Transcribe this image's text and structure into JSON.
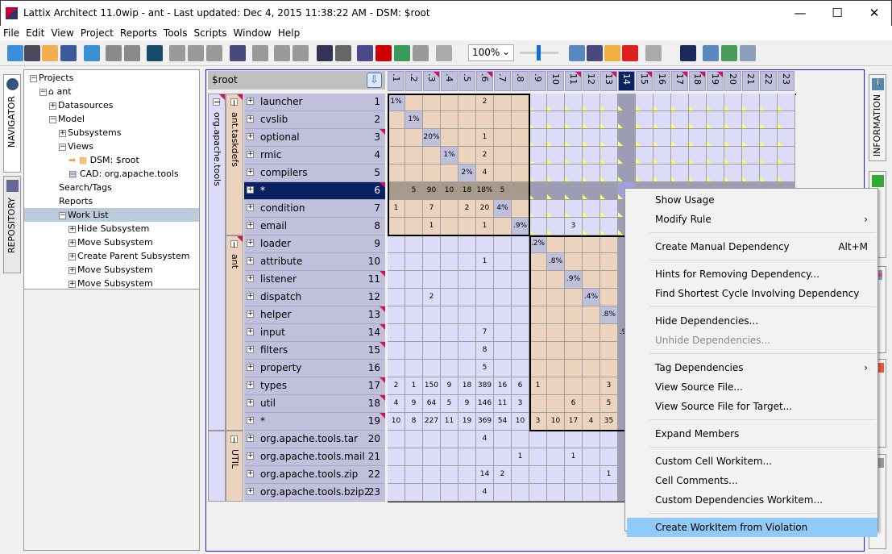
{
  "window": {
    "title": "Lattix Architect 11.0wip - ant - Last updated: Dec 4, 2015 11:38:22 AM - DSM: $root",
    "minimize": "—",
    "maximize": "☐",
    "close": "✕"
  },
  "menu": [
    "File",
    "Edit",
    "View",
    "Project",
    "Reports",
    "Tools",
    "Scripts",
    "Window",
    "Help"
  ],
  "toolbar": {
    "zoom": "100%",
    "zoom_slider_percent": 50,
    "icons": [
      "new-project-icon",
      "repository-icon",
      "open-icon",
      "save-icon",
      "refresh-icon",
      "undo-icon",
      "redo-icon",
      "search-icon",
      "cut-icon",
      "copy-icon",
      "paste-icon",
      "new-subsystem-icon",
      "delete-icon",
      "move-down-icon",
      "move-up-icon",
      "expand-icon",
      "collapse-icon",
      "home-icon",
      "violation-icon",
      "back-icon",
      "forward-icon",
      "grid-icon"
    ]
  },
  "left_tabs": [
    "NAVIGATOR",
    "REPOSITORY"
  ],
  "right_tabs": [
    "INFORMATION"
  ],
  "nav": [
    {
      "label": "Projects",
      "level": 0,
      "pm": "−"
    },
    {
      "label": "ant",
      "level": 1,
      "pm": "−"
    },
    {
      "label": "Datasources",
      "level": 2,
      "pm": "+"
    },
    {
      "label": "Model",
      "level": 2,
      "pm": "−"
    },
    {
      "label": "Subsystems",
      "level": 3,
      "pm": "+"
    },
    {
      "label": "Views",
      "level": 3,
      "pm": "−"
    },
    {
      "label": "DSM: $root",
      "level": 4,
      "pm": ""
    },
    {
      "label": "CAD: org.apache.tools",
      "level": 4,
      "pm": ""
    },
    {
      "label": "Search/Tags",
      "level": 3,
      "pm": ""
    },
    {
      "label": "Reports",
      "level": 3,
      "pm": ""
    },
    {
      "label": "Work List",
      "level": 3,
      "pm": "−",
      "selected": true
    },
    {
      "label": "Hide Subsystem",
      "level": 4,
      "pm": "+"
    },
    {
      "label": "Move Subsystem",
      "level": 4,
      "pm": "+"
    },
    {
      "label": "Create Parent Subsystem",
      "level": 4,
      "pm": "+"
    },
    {
      "label": "Move Subsystem",
      "level": 4,
      "pm": "+"
    },
    {
      "label": "Move Subsystem",
      "level": 4,
      "pm": "+"
    }
  ],
  "dsm": {
    "root": "$root",
    "selected_row": 6,
    "selected_col": 14,
    "columns": [
      ".1",
      ".2",
      ".3",
      ".4",
      ".5",
      ".6",
      ".7",
      ".8",
      ".9",
      "10",
      "11",
      "12",
      "13",
      "14",
      "15",
      "16",
      "17",
      "18",
      "19",
      "20",
      "21",
      "22",
      "23"
    ],
    "groups_l1": [
      {
        "label": "org.apache.tools",
        "from": 1,
        "to": 19
      }
    ],
    "groups_l2": [
      {
        "label": "ant.taskdefs",
        "from": 1,
        "to": 8
      },
      {
        "label": "ant",
        "from": 9,
        "to": 19
      },
      {
        "label": "UTIL",
        "from": 20,
        "to": 23
      }
    ],
    "rows": [
      "launcher",
      "cvslib",
      "optional",
      "rmic",
      "compilers",
      "*",
      "condition",
      "email",
      "loader",
      "attribute",
      "listener",
      "dispatch",
      "helper",
      "input",
      "filters",
      "property",
      "types",
      "util",
      "*",
      "org.apache.tools.tar",
      "org.apache.tools.mail",
      "org.apache.tools.zip",
      "org.apache.tools.bzip2"
    ],
    "cells": [
      [
        1,
        1,
        "1%"
      ],
      [
        1,
        6,
        "2"
      ],
      [
        2,
        2,
        "1%"
      ],
      [
        3,
        3,
        "20%"
      ],
      [
        3,
        6,
        "1"
      ],
      [
        4,
        4,
        "1%"
      ],
      [
        4,
        6,
        "2"
      ],
      [
        5,
        5,
        "2%"
      ],
      [
        5,
        6,
        "4"
      ],
      [
        6,
        2,
        "5"
      ],
      [
        6,
        3,
        "90"
      ],
      [
        6,
        4,
        "10"
      ],
      [
        6,
        5,
        "18"
      ],
      [
        6,
        6,
        "18%"
      ],
      [
        6,
        7,
        "5"
      ],
      [
        7,
        1,
        "1"
      ],
      [
        7,
        3,
        "7"
      ],
      [
        7,
        5,
        "2"
      ],
      [
        7,
        6,
        "20"
      ],
      [
        7,
        7,
        "4%"
      ],
      [
        8,
        3,
        "1"
      ],
      [
        8,
        6,
        "1"
      ],
      [
        8,
        8,
        ".9%"
      ],
      [
        8,
        11,
        "3"
      ],
      [
        9,
        9,
        ".2%"
      ],
      [
        10,
        6,
        "1"
      ],
      [
        10,
        10,
        ".8%"
      ],
      [
        11,
        11,
        ".9%"
      ],
      [
        12,
        3,
        "2"
      ],
      [
        12,
        12,
        ".4%"
      ],
      [
        13,
        13,
        ".8%"
      ],
      [
        14,
        6,
        "7"
      ],
      [
        14,
        14,
        ".9%"
      ],
      [
        15,
        6,
        "8"
      ],
      [
        16,
        6,
        "5"
      ],
      [
        17,
        1,
        "2"
      ],
      [
        17,
        2,
        "1"
      ],
      [
        17,
        3,
        "150"
      ],
      [
        17,
        4,
        "9"
      ],
      [
        17,
        5,
        "18"
      ],
      [
        17,
        6,
        "389"
      ],
      [
        17,
        7,
        "16"
      ],
      [
        17,
        8,
        "6"
      ],
      [
        17,
        9,
        "1"
      ],
      [
        17,
        13,
        "3"
      ],
      [
        18,
        1,
        "4"
      ],
      [
        18,
        2,
        "9"
      ],
      [
        18,
        3,
        "64"
      ],
      [
        18,
        4,
        "5"
      ],
      [
        18,
        5,
        "9"
      ],
      [
        18,
        6,
        "146"
      ],
      [
        18,
        7,
        "11"
      ],
      [
        18,
        8,
        "3"
      ],
      [
        18,
        11,
        "6"
      ],
      [
        18,
        13,
        "5"
      ],
      [
        19,
        1,
        "10"
      ],
      [
        19,
        2,
        "8"
      ],
      [
        19,
        3,
        "227"
      ],
      [
        19,
        4,
        "11"
      ],
      [
        19,
        5,
        "19"
      ],
      [
        19,
        6,
        "369"
      ],
      [
        19,
        7,
        "54"
      ],
      [
        19,
        8,
        "10"
      ],
      [
        19,
        9,
        "3"
      ],
      [
        19,
        10,
        "10"
      ],
      [
        19,
        11,
        "17"
      ],
      [
        19,
        12,
        "4"
      ],
      [
        19,
        13,
        "35"
      ],
      [
        20,
        6,
        "4"
      ],
      [
        21,
        8,
        "1"
      ],
      [
        21,
        11,
        "1"
      ],
      [
        22,
        6,
        "14"
      ],
      [
        22,
        7,
        "2"
      ],
      [
        22,
        13,
        "1"
      ],
      [
        23,
        6,
        "4"
      ]
    ],
    "flagged_rows": [
      3,
      6,
      11,
      13,
      14,
      15,
      17,
      18,
      19
    ],
    "flagged_cols": [
      3,
      6,
      11,
      13,
      15,
      17,
      18,
      19
    ],
    "colors": {
      "block": "#ebd3bd",
      "offblock": "#dcdcf8",
      "diagonal": "#c0c0dc",
      "selected": "#0a2264"
    }
  },
  "context_menu": [
    {
      "label": "Show Usage"
    },
    {
      "label": "Modify Rule",
      "sub": true
    },
    {
      "sep": true
    },
    {
      "label": "Create Manual Dependency",
      "shortcut": "Alt+M"
    },
    {
      "sep": true
    },
    {
      "label": "Hints for Removing Dependency..."
    },
    {
      "label": "Find Shortest Cycle Involving Dependency"
    },
    {
      "sep": true
    },
    {
      "label": "Hide Dependencies..."
    },
    {
      "label": "Unhide Dependencies...",
      "disabled": true
    },
    {
      "sep": true
    },
    {
      "label": "Tag Dependencies",
      "sub": true
    },
    {
      "label": "View Source File..."
    },
    {
      "label": "View Source File for Target..."
    },
    {
      "sep": true
    },
    {
      "label": "Expand Members"
    },
    {
      "sep": true
    },
    {
      "label": "Custom Cell Workitem..."
    },
    {
      "label": "Cell Comments..."
    },
    {
      "label": "Custom Dependencies Workitem..."
    },
    {
      "sep": true
    },
    {
      "label": "Create WorkItem from Violation",
      "highlighted": true
    }
  ]
}
